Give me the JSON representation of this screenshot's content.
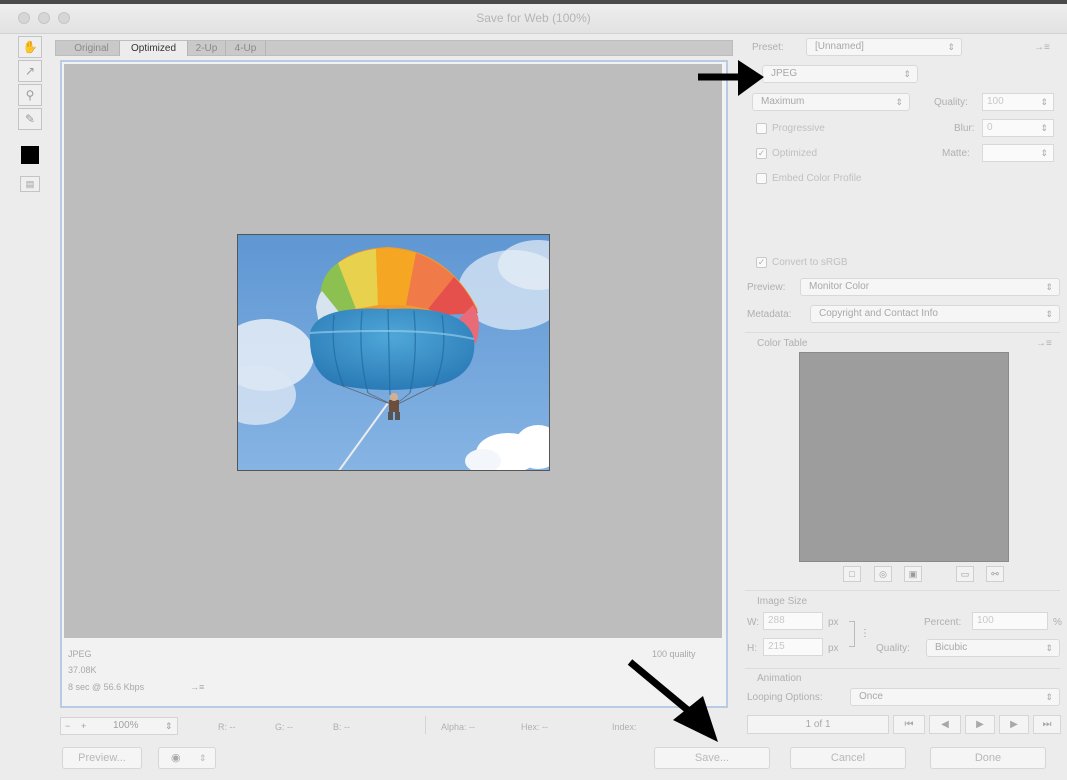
{
  "window": {
    "title": "Save for Web (100%)"
  },
  "tabs": [
    "Original",
    "Optimized",
    "2-Up",
    "4-Up"
  ],
  "canvas": {
    "format": "JPEG",
    "file_size": "37.08K",
    "download_time": "8 sec @ 56.6 Kbps",
    "download_menu_glyph": "→≡",
    "quality_text": "100 quality"
  },
  "status_bar": {
    "zoom": "100%",
    "r": "R: --",
    "g": "G: --",
    "b": "B: --",
    "alpha": "Alpha: --",
    "hex": "Hex: --",
    "index": "Index:"
  },
  "buttons": {
    "preview": "Preview...",
    "save": "Save...",
    "cancel": "Cancel",
    "done": "Done"
  },
  "settings": {
    "preset_label": "Preset:",
    "preset_value": "[Unnamed]",
    "format_value": "JPEG",
    "compression_value": "Maximum",
    "quality_label": "Quality:",
    "quality_value": "100",
    "blur_label": "Blur:",
    "blur_value": "0",
    "matte_label": "Matte:",
    "progressive_label": "Progressive",
    "optimized_label": "Optimized",
    "embed_profile_label": "Embed Color Profile",
    "convert_srgb_label": "Convert to sRGB",
    "preview_label": "Preview:",
    "preview_value": "Monitor Color",
    "metadata_label": "Metadata:",
    "metadata_value": "Copyright and Contact Info",
    "color_table_label": "Color Table",
    "panel_menu_glyph": "→≡"
  },
  "image_size": {
    "label": "Image Size",
    "w_label": "W:",
    "w_value": "288",
    "h_label": "H:",
    "h_value": "215",
    "unit": "px",
    "percent_label": "Percent:",
    "percent_value": "100",
    "percent_sign": "%",
    "quality_label": "Quality:",
    "quality_value": "Bicubic"
  },
  "animation": {
    "label": "Animation",
    "looping_label": "Looping Options:",
    "looping_value": "Once",
    "frame_counter": "1 of 1"
  },
  "colors": {
    "canvas_gray": "#bdbdbd",
    "color_table": "#9d9d9d",
    "selection_border": "#b9cbe3",
    "sky": "#6a9fd6"
  }
}
